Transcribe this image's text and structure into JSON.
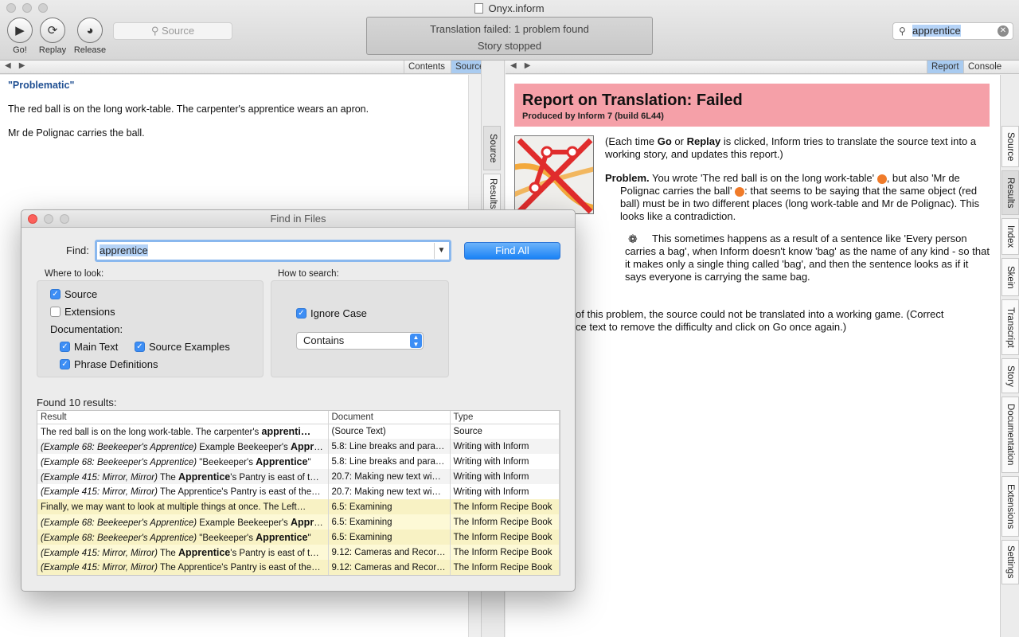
{
  "window": {
    "title": "Onyx.inform",
    "toolbar": {
      "go_label": "Go!",
      "replay_label": "Replay",
      "release_label": "Release",
      "source_search_placeholder": "Source",
      "status_line1": "Translation failed: 1 problem found",
      "status_line2": "Story stopped",
      "search_value": "apprentice"
    }
  },
  "left_pane": {
    "tabs": [
      "Contents",
      "Source"
    ],
    "active_tab": "Source",
    "story_title": "\"Problematic\"",
    "lines": [
      "The red ball is on the long work-table. The carpenter's apprentice wears an apron.",
      "Mr de Polignac carries the ball."
    ],
    "side_tabs": [
      "Source",
      "Results"
    ]
  },
  "right_pane": {
    "tabs": [
      "Report",
      "Console"
    ],
    "active_tab": "Report",
    "report_title": "Report on Translation: Failed",
    "report_subtitle": "Produced by Inform 7 (build 6L44)",
    "intro": {
      "p1": "(Each time ",
      "go": "Go",
      "p2": " or ",
      "replay": "Replay",
      "p3": " is clicked, Inform tries to translate the source text into a working story, and updates this report.)"
    },
    "problem": {
      "label": "Problem.",
      "text_a": " You wrote 'The red ball is on the long work-table' ",
      "text_b": ", but also 'Mr de Polignac carries the ball' ",
      "text_c": ": that seems to be saying that the same object (red ball) must be in two different places (long work-table and Mr de Polignac). This looks like a contradiction."
    },
    "hint": "This sometimes happens as a result of a sentence like 'Every person carries a bag', when Inform doesn't know 'bag' as the name of any kind - so that it makes only a single thing called 'bag', and then the sentence looks as if it says everyone is carrying the same bag.",
    "conclusion_line1": "of this problem, the source could not be translated into a working game. (Correct",
    "conclusion_line2": "ce text to remove the difficulty and click on Go once again.)",
    "side_tabs": [
      "Source",
      "Results",
      "Index",
      "Skein",
      "Transcript",
      "Story",
      "Documentation",
      "Extensions",
      "Settings"
    ],
    "active_side_tab": "Results"
  },
  "find_dialog": {
    "title": "Find in Files",
    "find_label": "Find:",
    "find_value": "apprentice",
    "find_all_label": "Find All",
    "where_label": "Where to look:",
    "how_label": "How to search:",
    "source_label": "Source",
    "source_checked": true,
    "extensions_label": "Extensions",
    "extensions_checked": false,
    "documentation_label": "Documentation:",
    "main_text_label": "Main Text",
    "main_text_checked": true,
    "source_examples_label": "Source Examples",
    "source_examples_checked": true,
    "phrase_definitions_label": "Phrase Definitions",
    "phrase_definitions_checked": true,
    "ignore_case_label": "Ignore Case",
    "ignore_case_checked": true,
    "match_mode": "Contains",
    "found_label": "Found 10 results:",
    "columns": [
      "Result",
      "Document",
      "Type"
    ],
    "results": [
      {
        "context": "",
        "pre": "The red ball is on the long work-table. The carpenter's ",
        "match": "apprenti…",
        "post": "",
        "document": "(Source Text)",
        "type": "Source"
      },
      {
        "context": "(Example 68: Beekeeper's Apprentice)",
        "pre": " Example Beekeeper's ",
        "match": "Appre…",
        "post": "",
        "document": "5.8: Line breaks and para…",
        "type": "Writing with Inform"
      },
      {
        "context": "(Example 68: Beekeeper's Apprentice)",
        "pre": " \"Beekeeper's ",
        "match": "Apprentice",
        "post": "\"",
        "document": "5.8: Line breaks and para…",
        "type": "Writing with Inform"
      },
      {
        "context": "(Example 415: Mirror, Mirror)",
        "pre": " The ",
        "match": "Apprentice",
        "post": "'s Pantry is east of t…",
        "document": "20.7: Making new text wi…",
        "type": "Writing with Inform"
      },
      {
        "context": "(Example 415: Mirror, Mirror)",
        "pre": " The Apprentice's Pantry is east of the…",
        "match": "",
        "post": "",
        "document": "20.7: Making new text wi…",
        "type": "Writing with Inform"
      },
      {
        "context": "",
        "pre": "Finally, we may want to look at multiple things at once. The Left…",
        "match": "",
        "post": "",
        "document": "6.5: Examining",
        "type": "The Inform Recipe Book"
      },
      {
        "context": "(Example 68: Beekeeper's Apprentice)",
        "pre": " Example Beekeeper's ",
        "match": "Appre…",
        "post": "",
        "document": "6.5: Examining",
        "type": "The Inform Recipe Book"
      },
      {
        "context": "(Example 68: Beekeeper's Apprentice)",
        "pre": " \"Beekeeper's ",
        "match": "Apprentice",
        "post": "\"",
        "document": "6.5: Examining",
        "type": "The Inform Recipe Book"
      },
      {
        "context": "(Example 415: Mirror, Mirror)",
        "pre": " The ",
        "match": "Apprentice",
        "post": "'s Pantry is east of t…",
        "document": "9.12: Cameras and Recor…",
        "type": "The Inform Recipe Book"
      },
      {
        "context": "(Example 415: Mirror, Mirror)",
        "pre": " The Apprentice's Pantry is east of the…",
        "match": "",
        "post": "",
        "document": "9.12: Cameras and Recor…",
        "type": "The Inform Recipe Book"
      }
    ]
  },
  "colors": {
    "report_banner": "#f5a0a8",
    "accent_blue": "#1a82f6",
    "story_title": "#1f4f92",
    "recipe_row": "#fdf9d6"
  }
}
